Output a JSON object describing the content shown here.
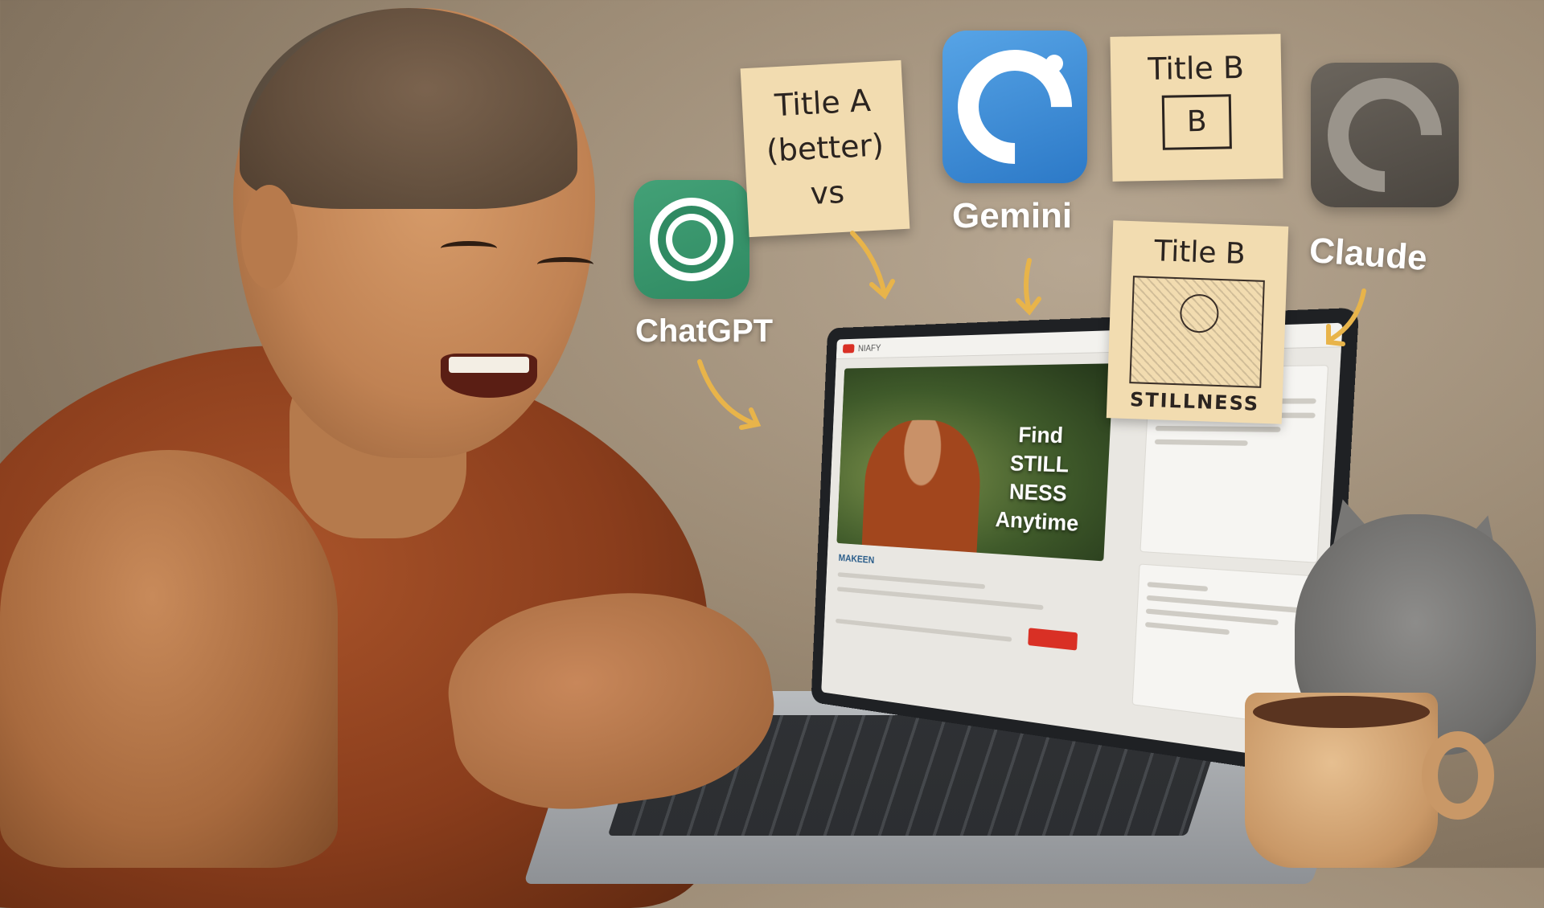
{
  "notes": {
    "a": {
      "line1": "Title A",
      "line2": "(better)",
      "line3": "vs"
    },
    "b": {
      "title": "Title B",
      "box": "B"
    },
    "c": {
      "title": "Title B",
      "caption": "STILLNESS"
    }
  },
  "apps": {
    "chatgpt": {
      "label": "ChatGPT",
      "icon": "chatgpt-knot-icon",
      "color": "#2f8a62"
    },
    "gemini": {
      "label": "Gemini",
      "icon": "gemini-c-icon",
      "color": "#3a8ad6"
    },
    "claude": {
      "label": "Claude",
      "icon": "claude-c-icon",
      "color": "#5a554e"
    }
  },
  "screen": {
    "brand": "NIAFY",
    "video_text": [
      "Find",
      "STILL NESS",
      "Anytime"
    ],
    "channel": "MAKEEN"
  },
  "colors": {
    "arrow": "#e8b44a",
    "note": "#f2dcb0",
    "robe": "#8a3d1c"
  }
}
